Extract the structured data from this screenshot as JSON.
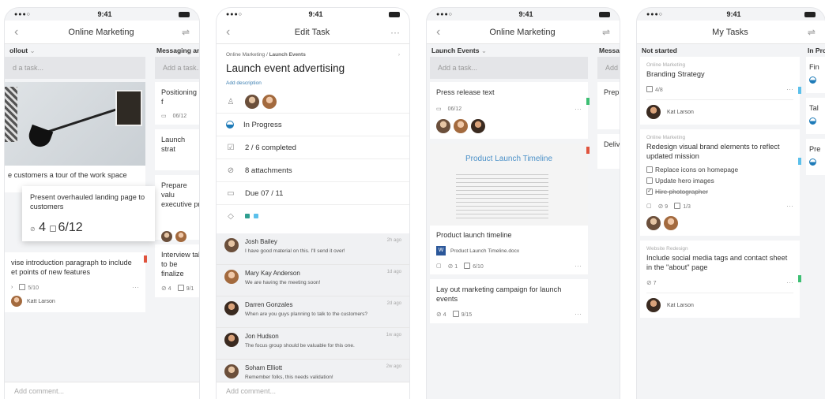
{
  "status": {
    "time": "9:41",
    "signal": "●●●○"
  },
  "screen1": {
    "title": "Online Marketing",
    "col1": {
      "head": "ollout",
      "add_placeholder": "d a task...",
      "image_caption": "e customers a tour of the work space",
      "drag_card": {
        "title": "Present overhauled landing page to customers",
        "attachments": "4",
        "checklist": "6/12"
      },
      "card2": {
        "title": "vise introduction paragraph to include et points of new features",
        "checklist": "5/10",
        "assignee": "Katt Larson"
      },
      "add_comment": "Add comment..."
    },
    "col2": {
      "head": "Messaging and",
      "add_placeholder": "Add a task...",
      "card1": {
        "title": "Positioning f",
        "date": "06/12"
      },
      "card2": {
        "title": "Launch strat"
      },
      "card3": {
        "title": "Prepare valu executive pr"
      },
      "card4": {
        "title": "Interview tal to be finalize",
        "attachments": "4",
        "checklist": "9/1"
      }
    }
  },
  "screen2": {
    "title": "Edit Task",
    "breadcrumb_project": "Online Marketing",
    "breadcrumb_sep": "/",
    "breadcrumb_bucket": "Launch Events",
    "task_title": "Launch event advertising",
    "add_description": "Add description",
    "progress": "In Progress",
    "checklist": "2 / 6 completed",
    "attachments": "8 attachments",
    "due": "Due 07 / 11",
    "label_colors": [
      "#2e9e8f",
      "#5bc0eb"
    ],
    "comments": [
      {
        "name": "Josh Bailey",
        "text": "I have good material on this. I'll send it over!",
        "time": "2h ago"
      },
      {
        "name": "Mary Kay Anderson",
        "text": "We are having the meeting soon!",
        "time": "1d ago"
      },
      {
        "name": "Darren Gonzales",
        "text": "When are you guys planning to talk to the customers?",
        "time": "2d ago"
      },
      {
        "name": "Jon Hudson",
        "text": "The focus group should be valuable for this one.",
        "time": "1w ago"
      },
      {
        "name": "Soham Elliott",
        "text": "Remember folks, this needs validation!",
        "time": "2w ago"
      }
    ],
    "add_comment": "Add comment..."
  },
  "screen3": {
    "title": "Online Marketing",
    "col1": {
      "head": "Launch Events",
      "add_placeholder": "Add a task...",
      "card1": {
        "title": "Press release text",
        "date": "06/12"
      },
      "card2": {
        "preview_title": "Product Launch Timeline",
        "title": "Product launch timeline",
        "file": "Product Launch Timeline.docx",
        "comments_icon": "comment-icon",
        "attachments": "1",
        "checklist": "6/10"
      },
      "card3": {
        "title": "Lay out marketing campaign for launch events",
        "attachments": "4",
        "checklist": "9/15"
      }
    },
    "col2": {
      "head": "Messag",
      "add_placeholder": "Add",
      "card1": {
        "title": "Prep"
      },
      "card2": {
        "title": "Deliv"
      }
    }
  },
  "screen4": {
    "title": "My Tasks",
    "col1": {
      "head": "Not started",
      "card1": {
        "project": "Online Marketing",
        "title": "Branding Strategy",
        "checklist": "4/8",
        "assignee": "Kat Larson"
      },
      "card2": {
        "project": "Online Marketing",
        "title": "Redesign visual brand elements to reflect updated mission",
        "items": [
          {
            "label": "Replace icons on homepage",
            "done": false
          },
          {
            "label": "Update hero images",
            "done": false
          },
          {
            "label": "Hire photographer",
            "done": true
          }
        ],
        "attachments": "9",
        "checklist": "1/3"
      },
      "card3": {
        "project": "Website Redesign",
        "title": "Include social media tags and contact sheet in the \"about\" page",
        "attachments": "7",
        "assignee": "Kat Larson"
      }
    },
    "col2": {
      "head": "In Pro",
      "card1": {
        "title": "Fin"
      },
      "card2": {
        "title": "Tal"
      },
      "card3": {
        "title": "Pre"
      }
    }
  }
}
